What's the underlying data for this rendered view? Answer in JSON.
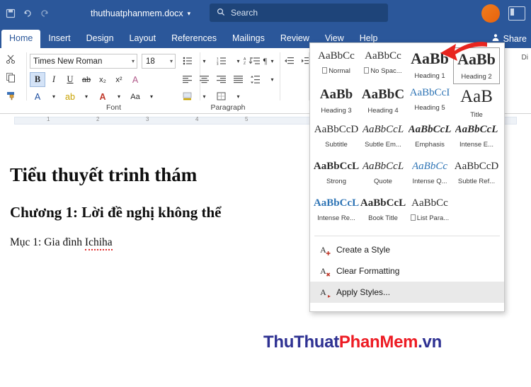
{
  "titlebar": {
    "doc_title": "thuthuatphanmem.docx",
    "caret": "▾",
    "search_placeholder": "Search",
    "search_icon": "search-icon",
    "save_icon": "save-icon",
    "undo_icon": "undo-icon",
    "redo_icon": "redo-icon"
  },
  "tabs": [
    {
      "label": "Home",
      "active": true
    },
    {
      "label": "Insert",
      "active": false
    },
    {
      "label": "Design",
      "active": false
    },
    {
      "label": "Layout",
      "active": false
    },
    {
      "label": "References",
      "active": false
    },
    {
      "label": "Mailings",
      "active": false
    },
    {
      "label": "Review",
      "active": false
    },
    {
      "label": "View",
      "active": false
    },
    {
      "label": "Help",
      "active": false
    }
  ],
  "share": {
    "label": "Share",
    "icon": "share-person-icon"
  },
  "ribbon": {
    "clipboard": {
      "group_label": "",
      "cut_icon": "scissors-icon",
      "copy_icon": "copy-icon",
      "format_painter_icon": "paintbrush-icon"
    },
    "font": {
      "group_label": "Font",
      "font_name": "Times New Roman",
      "font_size": "18",
      "caret": "▾",
      "buttons": [
        {
          "name": "bold",
          "glyph": "B",
          "selected": true
        },
        {
          "name": "italic",
          "glyph": "I",
          "selected": false
        },
        {
          "name": "underline",
          "glyph": "U",
          "selected": false
        },
        {
          "name": "strikethrough",
          "glyph": "ab",
          "selected": false
        },
        {
          "name": "subscript",
          "glyph": "x₂",
          "selected": false
        },
        {
          "name": "superscript",
          "glyph": "x²",
          "selected": false
        },
        {
          "name": "clear-formatting",
          "glyph": "A",
          "selected": false
        }
      ],
      "buttons2": [
        {
          "name": "text-effects",
          "glyph": "A",
          "selected": false
        },
        {
          "name": "text-highlight-color",
          "glyph": "ab",
          "selected": false
        },
        {
          "name": "font-color",
          "glyph": "A",
          "selected": false
        },
        {
          "name": "change-case",
          "glyph": "Aa",
          "selected": false
        },
        {
          "name": "grow-font",
          "glyph": "A",
          "selected": false
        }
      ]
    },
    "paragraph": {
      "group_label": "Paragraph",
      "row1": [
        "bullets-icon",
        "numbering-icon",
        "multilevel-list-icon",
        "decrease-indent-icon",
        "increase-indent-icon",
        "sort-icon"
      ],
      "row2": [
        "align-left-icon",
        "align-center-icon",
        "align-right-icon",
        "justify-icon",
        "line-spacing-icon",
        "shading-icon",
        "borders-icon",
        "show-marks-icon"
      ]
    }
  },
  "ruler": {
    "ticks": [
      "1",
      "2",
      "3",
      "4",
      "5"
    ]
  },
  "document": {
    "heading1": "Tiểu thuyết trinh thám",
    "heading2": "Chương 1: Lời đề nghị không thể",
    "paragraph_prefix": "Mục 1: Gia đình ",
    "paragraph_misspelled": "Ichiha"
  },
  "watermark": {
    "part1": "ThuThuat",
    "part2": "PhanMem",
    "part3": ".vn"
  },
  "styles_gallery": {
    "rows": [
      [
        {
          "preview": "AaBbCc",
          "name": "Normal",
          "selected": false,
          "style": "normal",
          "pilcrow": true
        },
        {
          "preview": "AaBbCc",
          "name": "No Spac...",
          "selected": false,
          "style": "normal",
          "pilcrow": true
        },
        {
          "preview": "AaBb",
          "name": "Heading 1",
          "selected": false,
          "style": "h1"
        },
        {
          "preview": "AaBb",
          "name": "Heading 2",
          "selected": true,
          "style": "h2"
        }
      ],
      [
        {
          "preview": "AaBb",
          "name": "Heading 3",
          "selected": false,
          "style": "h3"
        },
        {
          "preview": "AaBbC",
          "name": "Heading 4",
          "selected": false,
          "style": "h4"
        },
        {
          "preview": "AaBbCcI",
          "name": "Heading 5",
          "selected": false,
          "style": "h5"
        },
        {
          "preview": "AaB",
          "name": "Title",
          "selected": false,
          "style": "title"
        }
      ],
      [
        {
          "preview": "AaBbCcD",
          "name": "Subtitle",
          "selected": false,
          "style": "normal"
        },
        {
          "preview": "AaBbCcL",
          "name": "Subtle Em...",
          "selected": false,
          "style": "italic"
        },
        {
          "preview": "AaBbCcL",
          "name": "Emphasis",
          "selected": false,
          "style": "italic"
        },
        {
          "preview": "AaBbCcL",
          "name": "Intense E...",
          "selected": false,
          "style": "bolditalic"
        }
      ],
      [
        {
          "preview": "AaBbCcL",
          "name": "Strong",
          "selected": false,
          "style": "bold"
        },
        {
          "preview": "AaBbCcL",
          "name": "Quote",
          "selected": false,
          "style": "italic"
        },
        {
          "preview": "AaBbCc",
          "name": "Intense Q...",
          "selected": false,
          "style": "blueitalic"
        },
        {
          "preview": "AaBbCcD",
          "name": "Subtle Ref...",
          "selected": false,
          "style": "normal"
        }
      ],
      [
        {
          "preview": "AaBbCcL",
          "name": "Intense Re...",
          "selected": false,
          "style": "blue"
        },
        {
          "preview": "AaBbCcL",
          "name": "Book Title",
          "selected": false,
          "style": "bold"
        },
        {
          "preview": "AaBbCc",
          "name": "List Para...",
          "selected": false,
          "style": "normal",
          "pilcrow": true
        }
      ]
    ],
    "actions": [
      {
        "label": "Create a Style",
        "icon": "new-style-icon",
        "hover": false
      },
      {
        "label": "Clear Formatting",
        "icon": "clear-format-icon",
        "hover": false
      },
      {
        "label": "Apply Styles...",
        "icon": "apply-styles-icon",
        "hover": true
      }
    ]
  },
  "annotation": {
    "arrow_color": "#e8251f",
    "arrow_name": "red-arrow-pointer"
  }
}
